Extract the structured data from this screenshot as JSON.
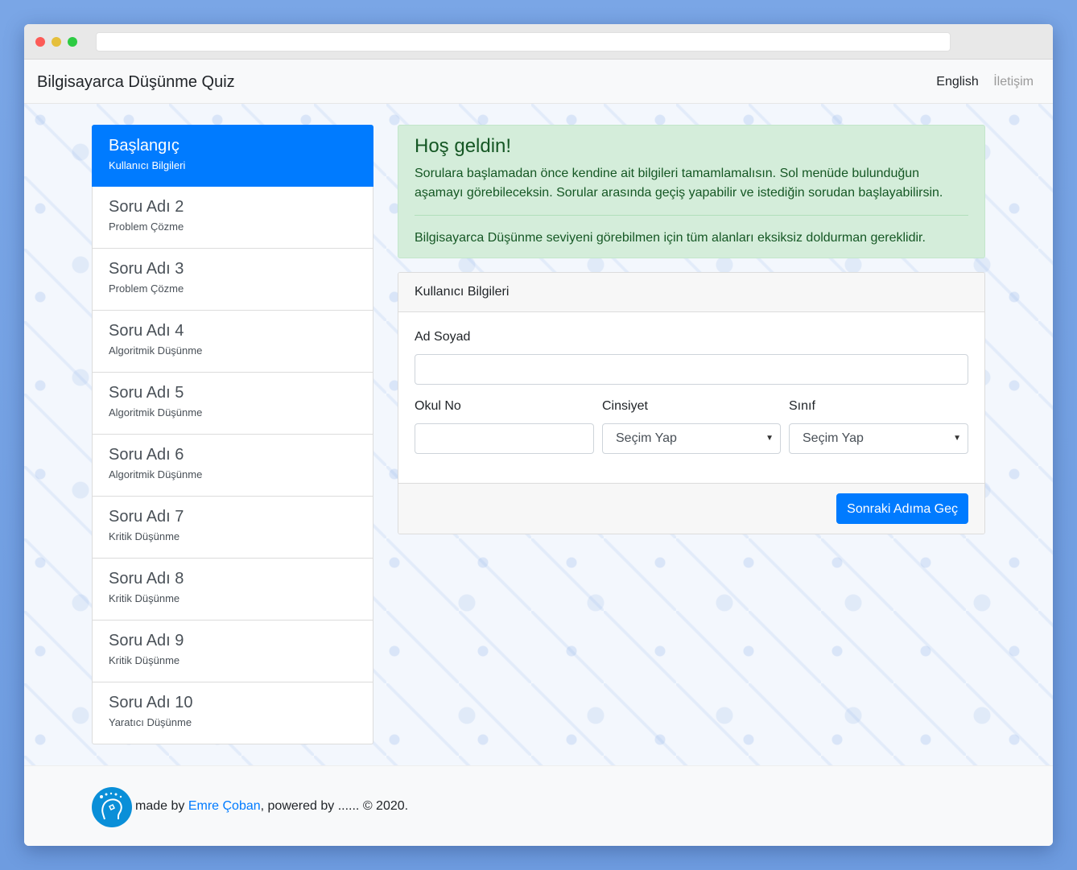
{
  "navbar": {
    "brand": "Bilgisayarca Düşünme Quiz",
    "language": "English",
    "contact": "İletişim"
  },
  "sidebar": {
    "items": [
      {
        "title": "Başlangıç",
        "subtitle": "Kullanıcı Bilgileri",
        "active": true
      },
      {
        "title": "Soru Adı 2",
        "subtitle": "Problem Çözme"
      },
      {
        "title": "Soru Adı 3",
        "subtitle": "Problem Çözme"
      },
      {
        "title": "Soru Adı 4",
        "subtitle": "Algoritmik Düşünme"
      },
      {
        "title": "Soru Adı 5",
        "subtitle": "Algoritmik Düşünme"
      },
      {
        "title": "Soru Adı 6",
        "subtitle": "Algoritmik Düşünme"
      },
      {
        "title": "Soru Adı 7",
        "subtitle": "Kritik Düşünme"
      },
      {
        "title": "Soru Adı 8",
        "subtitle": "Kritik Düşünme"
      },
      {
        "title": "Soru Adı 9",
        "subtitle": "Kritik Düşünme"
      },
      {
        "title": "Soru Adı 10",
        "subtitle": "Yaratıcı Düşünme"
      }
    ]
  },
  "alert": {
    "heading": "Hoş geldin!",
    "message": "Sorulara başlamadan önce kendine ait bilgileri tamamlamalısın. Sol menüde bulunduğun aşamayı görebileceksin. Sorular arasında geçiş yapabilir ve istediğin sorudan başlayabilirsin.",
    "note": "Bilgisayarca Düşünme seviyeni görebilmen için tüm alanları eksiksiz doldurman gereklidir."
  },
  "form": {
    "header": "Kullanıcı Bilgileri",
    "name_label": "Ad Soyad",
    "name_value": "",
    "school_no_label": "Okul No",
    "school_no_value": "",
    "gender_label": "Cinsiyet",
    "gender_selected": "Seçim Yap",
    "class_label": "Sınıf",
    "class_selected": "Seçim Yap",
    "next_button": "Sonraki Adıma Geç"
  },
  "footer": {
    "made_by": "made by ",
    "author": "Emre Çoban",
    "powered": ", powered by ...... © 2020."
  },
  "colors": {
    "primary": "#007bff",
    "success_bg": "#d4edda",
    "success_text": "#155724",
    "logo": "#0a8fd8"
  }
}
